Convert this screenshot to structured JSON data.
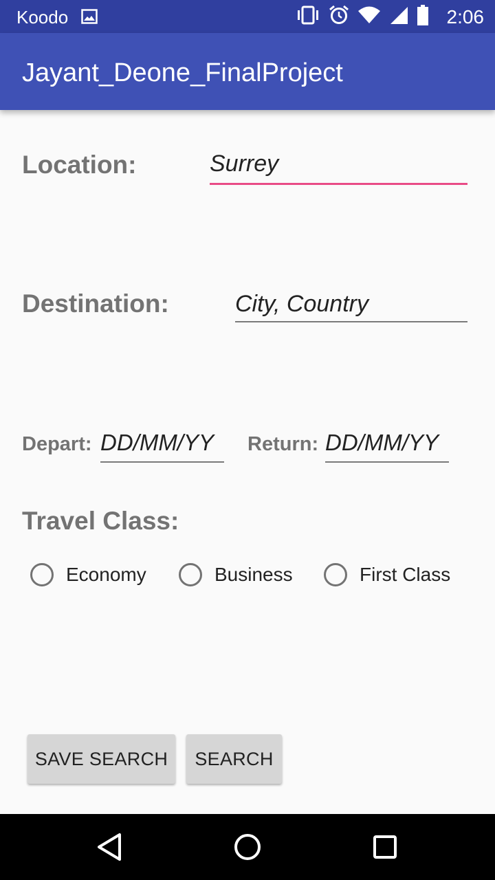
{
  "status_bar": {
    "carrier": "Koodo",
    "time": "2:06",
    "icons": [
      "image-icon",
      "vibrate-icon",
      "alarm-icon",
      "wifi-icon",
      "signal-icon",
      "battery-icon"
    ]
  },
  "app_bar": {
    "title": "Jayant_Deone_FinalProject"
  },
  "form": {
    "location_label": "Location:",
    "location_value": "Surrey",
    "destination_label": "Destination:",
    "destination_hint": "City, Country",
    "depart_label": "Depart:",
    "depart_hint": "DD/MM/YY",
    "return_label": "Return:",
    "return_hint": "DD/MM/YY",
    "travel_class_label": "Travel Class:",
    "travel_class_options": [
      "Economy",
      "Business",
      "First Class"
    ]
  },
  "buttons": {
    "save_search": "SAVE SEARCH",
    "search": "SEARCH"
  },
  "colors": {
    "status_bar": "#303f9f",
    "app_bar": "#3f51b5",
    "accent": "#e84b86",
    "background": "#fafafa"
  },
  "nav_bar": {
    "icons": [
      "back-icon",
      "home-icon",
      "recents-icon"
    ]
  }
}
